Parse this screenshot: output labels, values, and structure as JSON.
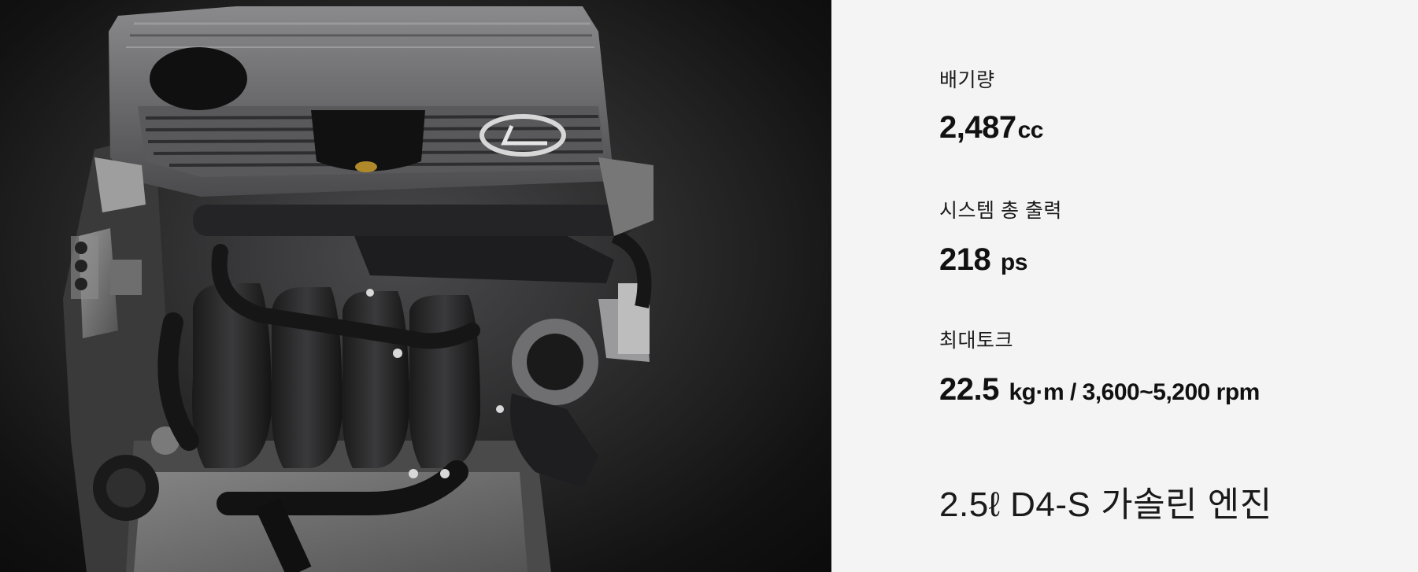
{
  "engine_image": {
    "logo": "lexus-logo"
  },
  "specs": [
    {
      "label": "배기량",
      "value": "2,487",
      "unit": "cc"
    },
    {
      "label": "시스템 총 출력",
      "value": "218",
      "unit": "ps"
    },
    {
      "label": "최대토크",
      "value": "22.5",
      "unit": "kg·m / 3,600~5,200 rpm"
    }
  ],
  "engine_name": "2.5ℓ D4-S 가솔린 엔진",
  "colors": {
    "background": "#f4f4f4",
    "image_background": "#121212",
    "text": "#111111"
  }
}
